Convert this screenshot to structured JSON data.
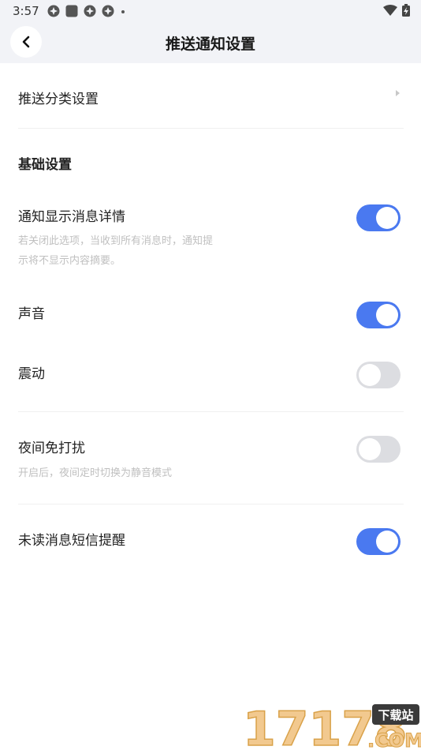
{
  "status_bar": {
    "time": "3:57"
  },
  "header": {
    "title": "推送通知设置",
    "back_icon": "chevron-left-icon"
  },
  "push_category": {
    "label": "推送分类设置"
  },
  "basic_section": {
    "title": "基础设置"
  },
  "settings": [
    {
      "label": "通知显示消息详情",
      "desc_lines": [
        "若关闭此选项，当收到所有消息时，通知提",
        "示将不显示内容摘要。"
      ],
      "on": true
    },
    {
      "label": "声音",
      "on": true
    },
    {
      "label": "震动",
      "on": false
    },
    {
      "label": "夜间免打扰",
      "desc_lines": [
        "开启后，夜间定时切换为静音模式"
      ],
      "on": false
    },
    {
      "label": "未读消息短信提醒",
      "on": true
    }
  ],
  "watermark": {
    "number": "17178",
    "site_label": "下载站",
    "domain": ".COM"
  },
  "colors": {
    "toggle_on": "#4a79f0",
    "toggle_off": "#dcdde1",
    "header_bg": "#f2f3f7",
    "desc_text": "#c0c0c0"
  }
}
